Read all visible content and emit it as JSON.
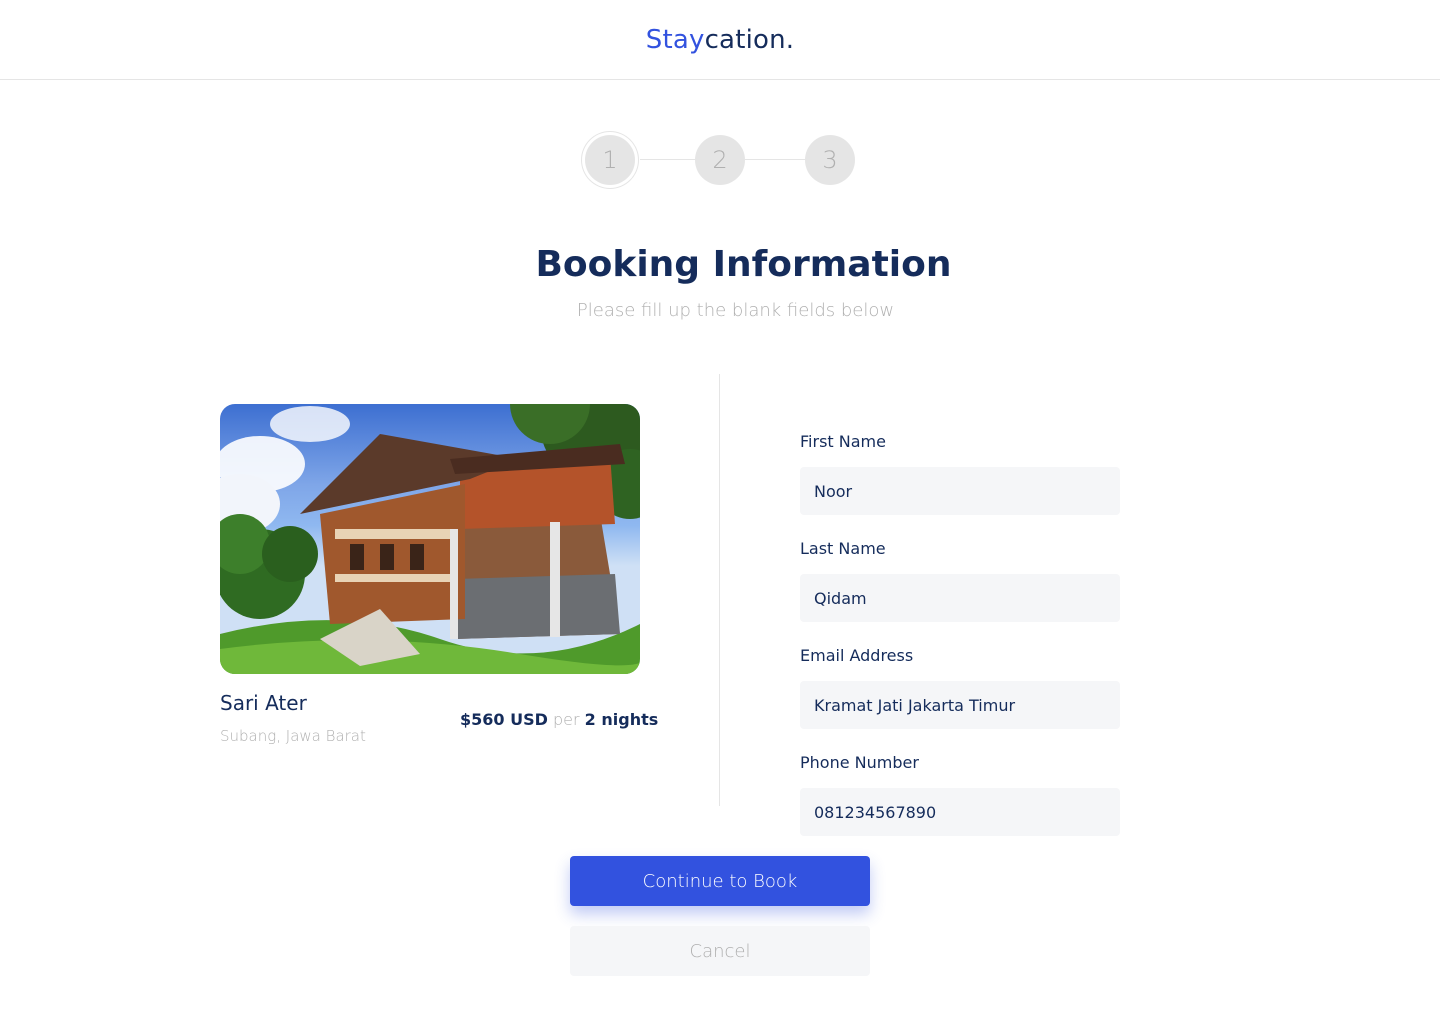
{
  "brand": {
    "accent_text": "Stay",
    "rest_text": "cation."
  },
  "colors": {
    "primary": "#3252DF",
    "navy": "#152C5B",
    "muted": "#B0B0B0",
    "input_bg": "#F5F6F8",
    "divider": "#E5E5E5"
  },
  "stepper": {
    "steps": [
      "1",
      "2",
      "3"
    ],
    "active_step": 1
  },
  "page": {
    "title": "Booking Information",
    "subtitle": "Please fill up the blank fields below"
  },
  "property": {
    "image_icon": "house-photo",
    "name": "Sari Ater",
    "location": "Subang, Jawa Barat",
    "price_amount": "$560 USD",
    "price_per": "per",
    "price_duration": "2 nights"
  },
  "form": {
    "first_name": {
      "label": "First Name",
      "value": "Noor"
    },
    "last_name": {
      "label": "Last Name",
      "value": "Qidam"
    },
    "email": {
      "label": "Email Address",
      "value": "Kramat Jati Jakarta Timur"
    },
    "phone": {
      "label": "Phone Number",
      "value": "081234567890"
    }
  },
  "actions": {
    "continue_label": "Continue to Book",
    "cancel_label": "Cancel"
  }
}
